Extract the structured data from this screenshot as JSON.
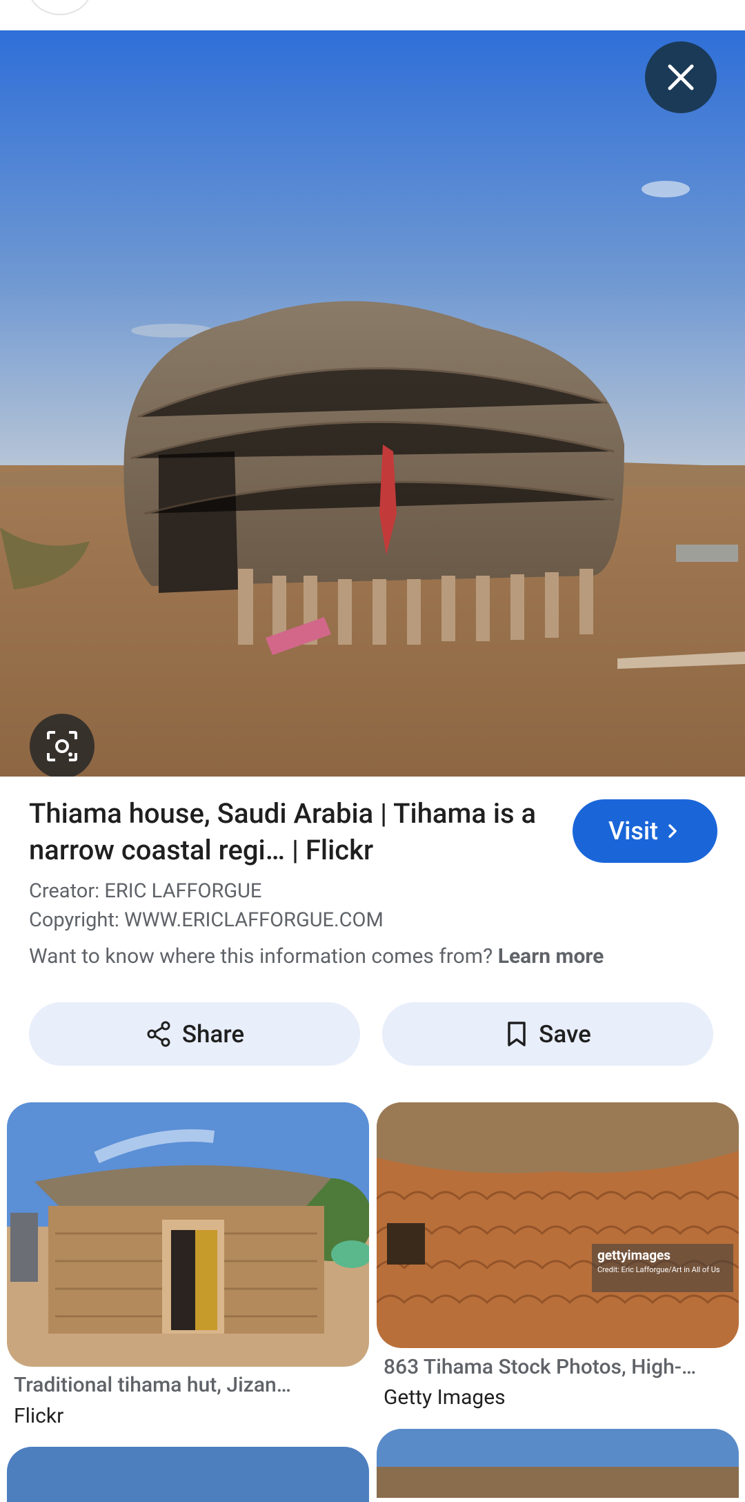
{
  "hero": {
    "title": "Thiama house, Saudi Arabia | Tihama is a narrow coastal regi… | Flickr",
    "visit_label": "Visit",
    "creator": "Creator: ERIC LAFFORGUE",
    "copyright": "Copyright: WWW.ERICLAFFORGUE.COM",
    "info_text": "Want to know where this information comes from?",
    "learn_more": "Learn more"
  },
  "actions": {
    "share_label": "Share",
    "save_label": "Save"
  },
  "results": [
    {
      "title": "Traditional tihama hut, Jizan…",
      "source": "Flickr"
    },
    {
      "title": "863 Tihama Stock Photos, High-…",
      "source": "Getty Images"
    }
  ],
  "watermark": {
    "brand": "gettyimages",
    "credit": "Credit: Eric Lafforgue/Art in All of Us"
  },
  "colors": {
    "accent": "#1a66d9",
    "button_bg": "#e8eefa",
    "close_bg": "#1b3a57"
  },
  "icons": [
    "close-icon",
    "lens-icon",
    "chevron-right-icon",
    "share-icon",
    "bookmark-icon"
  ]
}
